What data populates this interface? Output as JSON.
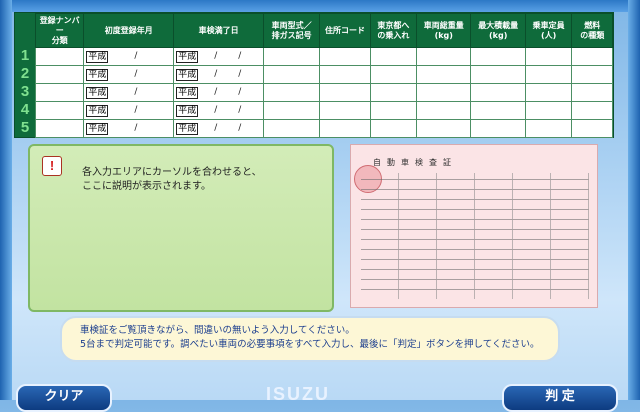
{
  "table": {
    "headers": [
      "登録ナンバー\n分類",
      "初度登録年月",
      "車検満了日",
      "車両型式／\n排ガス記号",
      "住所コード",
      "東京都へ\nの乗入れ",
      "車両総重量\n(kg)",
      "最大積載量\n(kg)",
      "乗車定員\n(人)",
      "燃料\nの種類"
    ],
    "row_numbers": [
      "1",
      "2",
      "3",
      "4",
      "5"
    ],
    "era_label": "平成",
    "slash": "/"
  },
  "info": {
    "line1": "各入力エリアにカーソルを合わせると、",
    "line2": "ここに説明が表示されます。"
  },
  "certificate": {
    "title": "自動車検査証"
  },
  "note": {
    "line1": "車検証をご覧頂きながら、間違いの無いよう入力してください。",
    "line2": "5台まで判定可能です。調べたい車両の必要事項をすべて入力し、最後に「判定」ボタンを押してください。"
  },
  "buttons": {
    "clear": "クリア",
    "judge": "判 定"
  },
  "logo_text": "ISUZU"
}
